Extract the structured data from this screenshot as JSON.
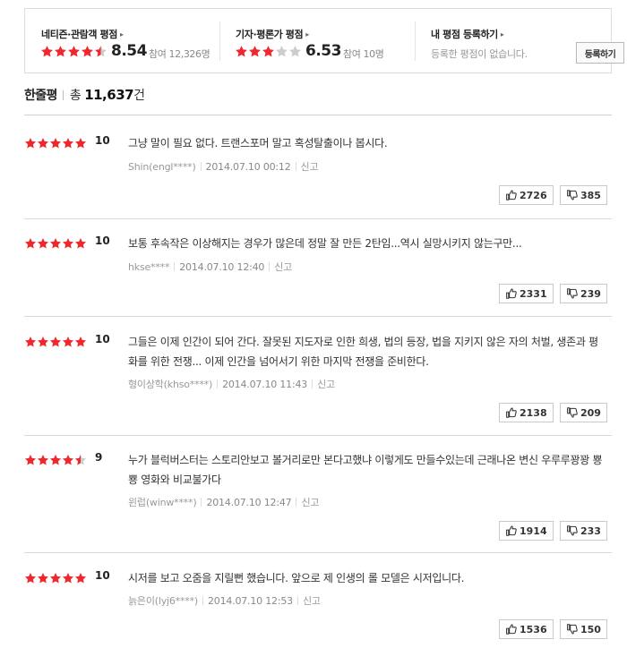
{
  "summary": {
    "netizen": {
      "title": "네티즌·관람객 평점",
      "arrow": "▸",
      "score": "8.54",
      "count_label": "참여 12,326명",
      "stars": 4.5
    },
    "critic": {
      "title": "기자·평론가 평점",
      "arrow": "▸",
      "score": "6.53",
      "count_label": "참여 10명",
      "stars": 3.0
    },
    "mine": {
      "title": "내 평점 등록하기",
      "arrow": "▸",
      "empty_text": "등록한 평점이 없습니다.",
      "register_label": "등록하기"
    }
  },
  "section": {
    "title": "한줄평",
    "total_prefix": "총",
    "total_count": "11,637",
    "total_suffix": "건"
  },
  "colors": {
    "star_on": "#f0282d",
    "star_off": "#cccccc",
    "border": "#dcdcdc"
  },
  "icons": {
    "like": "thumbs-up-icon",
    "dislike": "thumbs-down-icon"
  },
  "reviews": [
    {
      "stars": 5.0,
      "score": "10",
      "text": "그냥 말이 필요 없다. 트랜스포머 말고 혹성탈출이나 봅시다.",
      "user": "Shin(engl****)",
      "date": "2014.07.10 00:12",
      "report": "신고",
      "likes": "2726",
      "dislikes": "385"
    },
    {
      "stars": 5.0,
      "score": "10",
      "text": "보통 후속작은 이상해지는 경우가 많은데 정말 잘 만든 2탄임...역시 실망시키지 않는구만...",
      "user": "hkse****",
      "date": "2014.07.10 12:40",
      "report": "신고",
      "likes": "2331",
      "dislikes": "239"
    },
    {
      "stars": 5.0,
      "score": "10",
      "text": "그들은 이제 인간이 되어 간다. 잘못된 지도자로 인한 희생, 법의 등장, 법을 지키지 않은 자의 처벌, 생존과 평화를 위한 전쟁... 이제 인간을 넘어서기 위한 마지막 전쟁을 준비한다.",
      "user": "형이상학(khso****)",
      "date": "2014.07.10 11:43",
      "report": "신고",
      "likes": "2138",
      "dislikes": "209"
    },
    {
      "stars": 4.5,
      "score": "9",
      "text": "누가 블럭버스터는 스토리안보고 볼거리로만 본다고했냐 이렇게도 만들수있는데 근래나온 변신 우루루꽝꽝 뿅뿅 영화와 비교불가다",
      "user": "윈럽(winw****)",
      "date": "2014.07.10 12:47",
      "report": "신고",
      "likes": "1914",
      "dislikes": "233"
    },
    {
      "stars": 5.0,
      "score": "10",
      "text": "시저를 보고 오줌을 지릴뻔 했습니다. 앞으로 제 인생의 롤 모델은 시저입니다.",
      "user": "늙은이(lyj6****)",
      "date": "2014.07.10 12:53",
      "report": "신고",
      "likes": "1536",
      "dislikes": "150"
    }
  ]
}
